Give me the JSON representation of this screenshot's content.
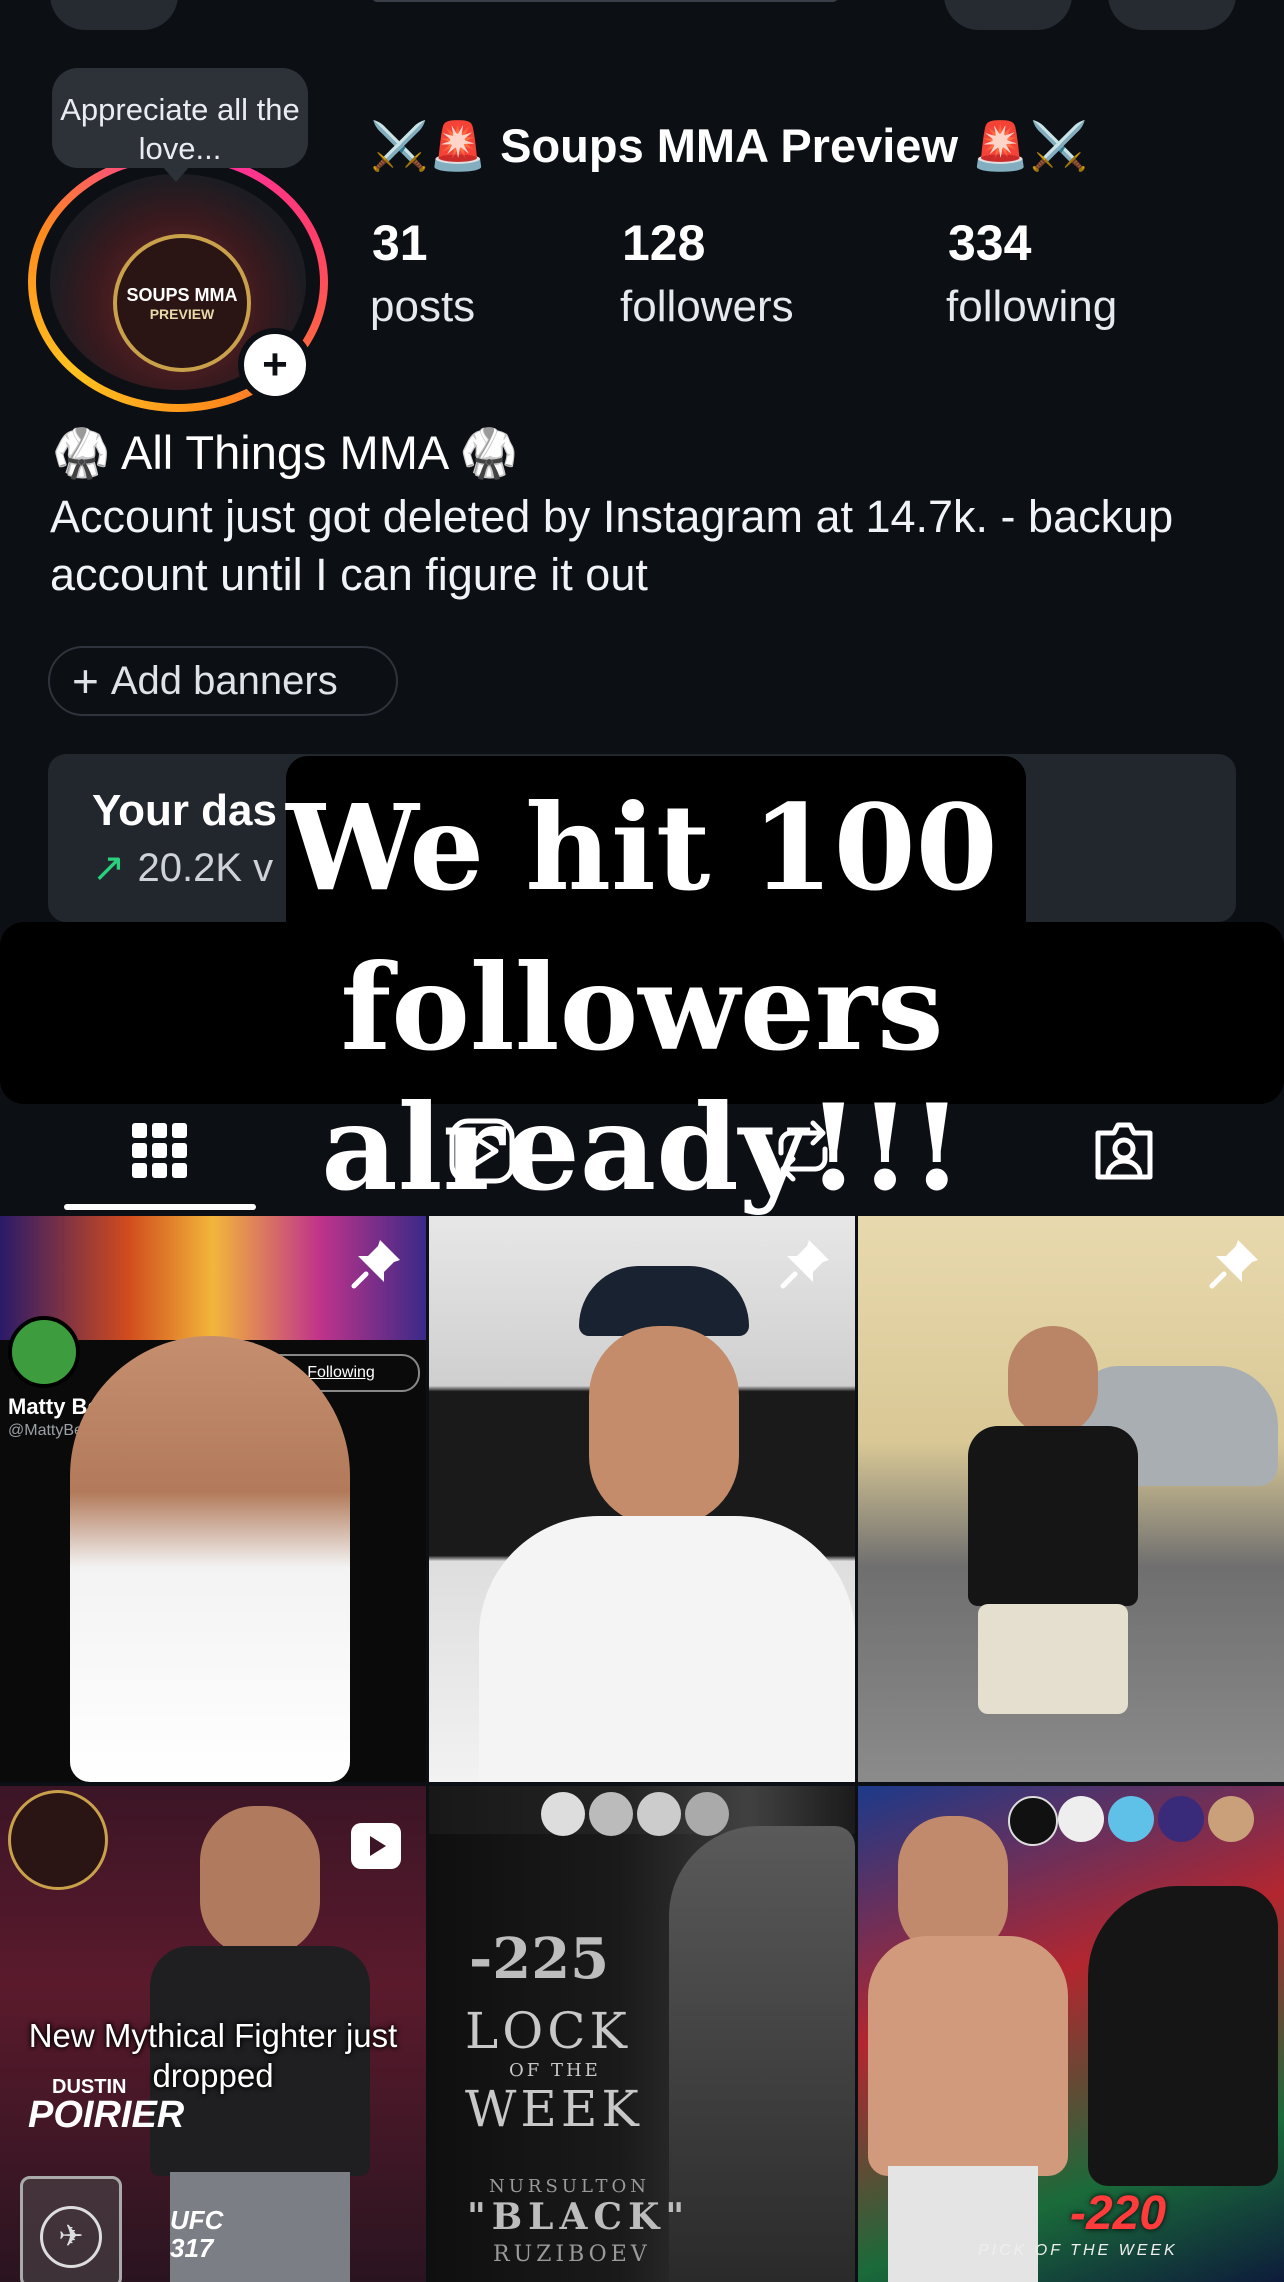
{
  "profile": {
    "name": "⚔️🚨 Soups MMA Preview 🚨⚔️",
    "note": "Appreciate all the love...",
    "avatar_logo_line1": "SOUPS MMA",
    "avatar_logo_line2": "PREVIEW",
    "stats": [
      {
        "value": "31",
        "label": "posts"
      },
      {
        "value": "128",
        "label": "followers"
      },
      {
        "value": "334",
        "label": "following"
      }
    ],
    "bio_line1": "🥋 All Things MMA 🥋",
    "bio_line2": "Account just got deleted by Instagram at 14.7k. - backup account until I can figure it out",
    "add_banners": "Add banners"
  },
  "dashboard": {
    "title": "Your das",
    "views": "20.2K v"
  },
  "overlay": {
    "line1": "We hit 100",
    "line2": "followers already!!!"
  },
  "tabs": [
    {
      "name": "grid",
      "icon": "grid-icon",
      "active": true
    },
    {
      "name": "reels",
      "icon": "reels-icon",
      "active": false
    },
    {
      "name": "reposts",
      "icon": "repost-icon",
      "active": false
    },
    {
      "name": "tagged",
      "icon": "tagged-icon",
      "active": false
    }
  ],
  "grid": {
    "tile1": {
      "handle_name": "Matty Betss",
      "handle": "@MattyBetss",
      "following": "Following",
      "pinned": true
    },
    "tile2": {
      "pinned": true
    },
    "tile3": {
      "pinned": true
    },
    "tile4": {
      "caption": "New Mythical Fighter just dropped",
      "fighter": "POIRIER",
      "fighter_first": "DUSTIN",
      "tag": "UFC 317",
      "reel": true
    },
    "tile5": {
      "odds": "-225",
      "lock_line1": "LOCK",
      "lock_line2": "OF THE",
      "lock_line3": "WEEK",
      "fighter_line1": "NURSULTON",
      "fighter_line2": "\"BLACK\"",
      "fighter_line3": "RUZIBOEV"
    },
    "tile6": {
      "odds": "-220",
      "pick": "PICK OF THE WEEK"
    }
  },
  "colors": {
    "background": "#0c0f14",
    "accent_green": "#29d07e",
    "story_ring": [
      "#ff2db0",
      "#ff8a1c",
      "#ffc21f"
    ]
  }
}
